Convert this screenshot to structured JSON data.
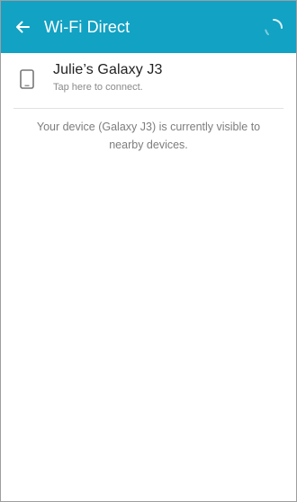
{
  "app_bar": {
    "title": "Wi-Fi Direct",
    "background_color": "#12a2c3",
    "back_icon": "arrow-left-icon",
    "progress_icon": "loading-spinner-icon"
  },
  "devices": [
    {
      "name": "Julie’s Galaxy J3",
      "subtitle": "Tap here to connect.",
      "icon": "phone-device-icon"
    }
  ],
  "visibility_note": "Your device (Galaxy J3) is currently visible to nearby devices."
}
